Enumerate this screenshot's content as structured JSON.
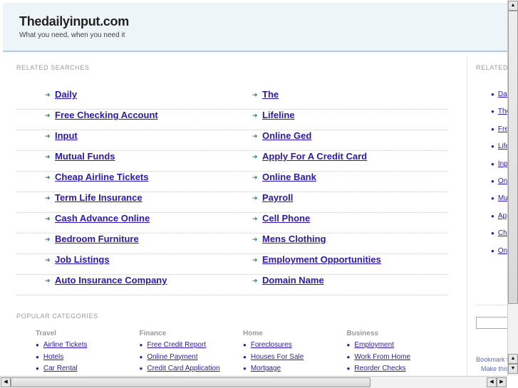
{
  "header": {
    "title": "Thedailyinput.com",
    "tagline": "What you need, when you need it"
  },
  "related": {
    "title": "RELATED SEARCHES",
    "left": [
      "Daily",
      "Free Checking Account",
      "Input",
      "Mutual Funds",
      "Cheap Airline Tickets",
      "Term Life Insurance",
      "Cash Advance Online",
      "Bedroom Furniture",
      "Job Listings",
      "Auto Insurance Company"
    ],
    "right": [
      "The",
      "Lifeline",
      "Online Ged",
      "Apply For A Credit Card",
      "Online Bank",
      "Payroll",
      "Cell Phone",
      "Mens Clothing",
      "Employment Opportunities",
      "Domain Name"
    ]
  },
  "popular": {
    "title": "POPULAR CATEGORIES",
    "categories": [
      {
        "name": "Travel",
        "links": [
          "Airline Tickets",
          "Hotels",
          "Car Rental"
        ]
      },
      {
        "name": "Finance",
        "links": [
          "Free Credit Report",
          "Online Payment",
          "Credit Card Application"
        ]
      },
      {
        "name": "Home",
        "links": [
          "Foreclosures",
          "Houses For Sale",
          "Mortgage"
        ]
      },
      {
        "name": "Business",
        "links": [
          "Employment",
          "Work From Home",
          "Reorder Checks"
        ]
      }
    ]
  },
  "sidebar": {
    "title": "RELATED",
    "links": [
      "Daily",
      "The",
      "Free Checking Account",
      "Lifeline",
      "Input",
      "Online Ged",
      "Mutual Funds",
      "Apply For A Credit Card",
      "Cheap Airline Tickets",
      "Online Bank"
    ],
    "search_value": "",
    "bookmark": "Bookmark this page",
    "make_home": "Make this your homepage"
  }
}
